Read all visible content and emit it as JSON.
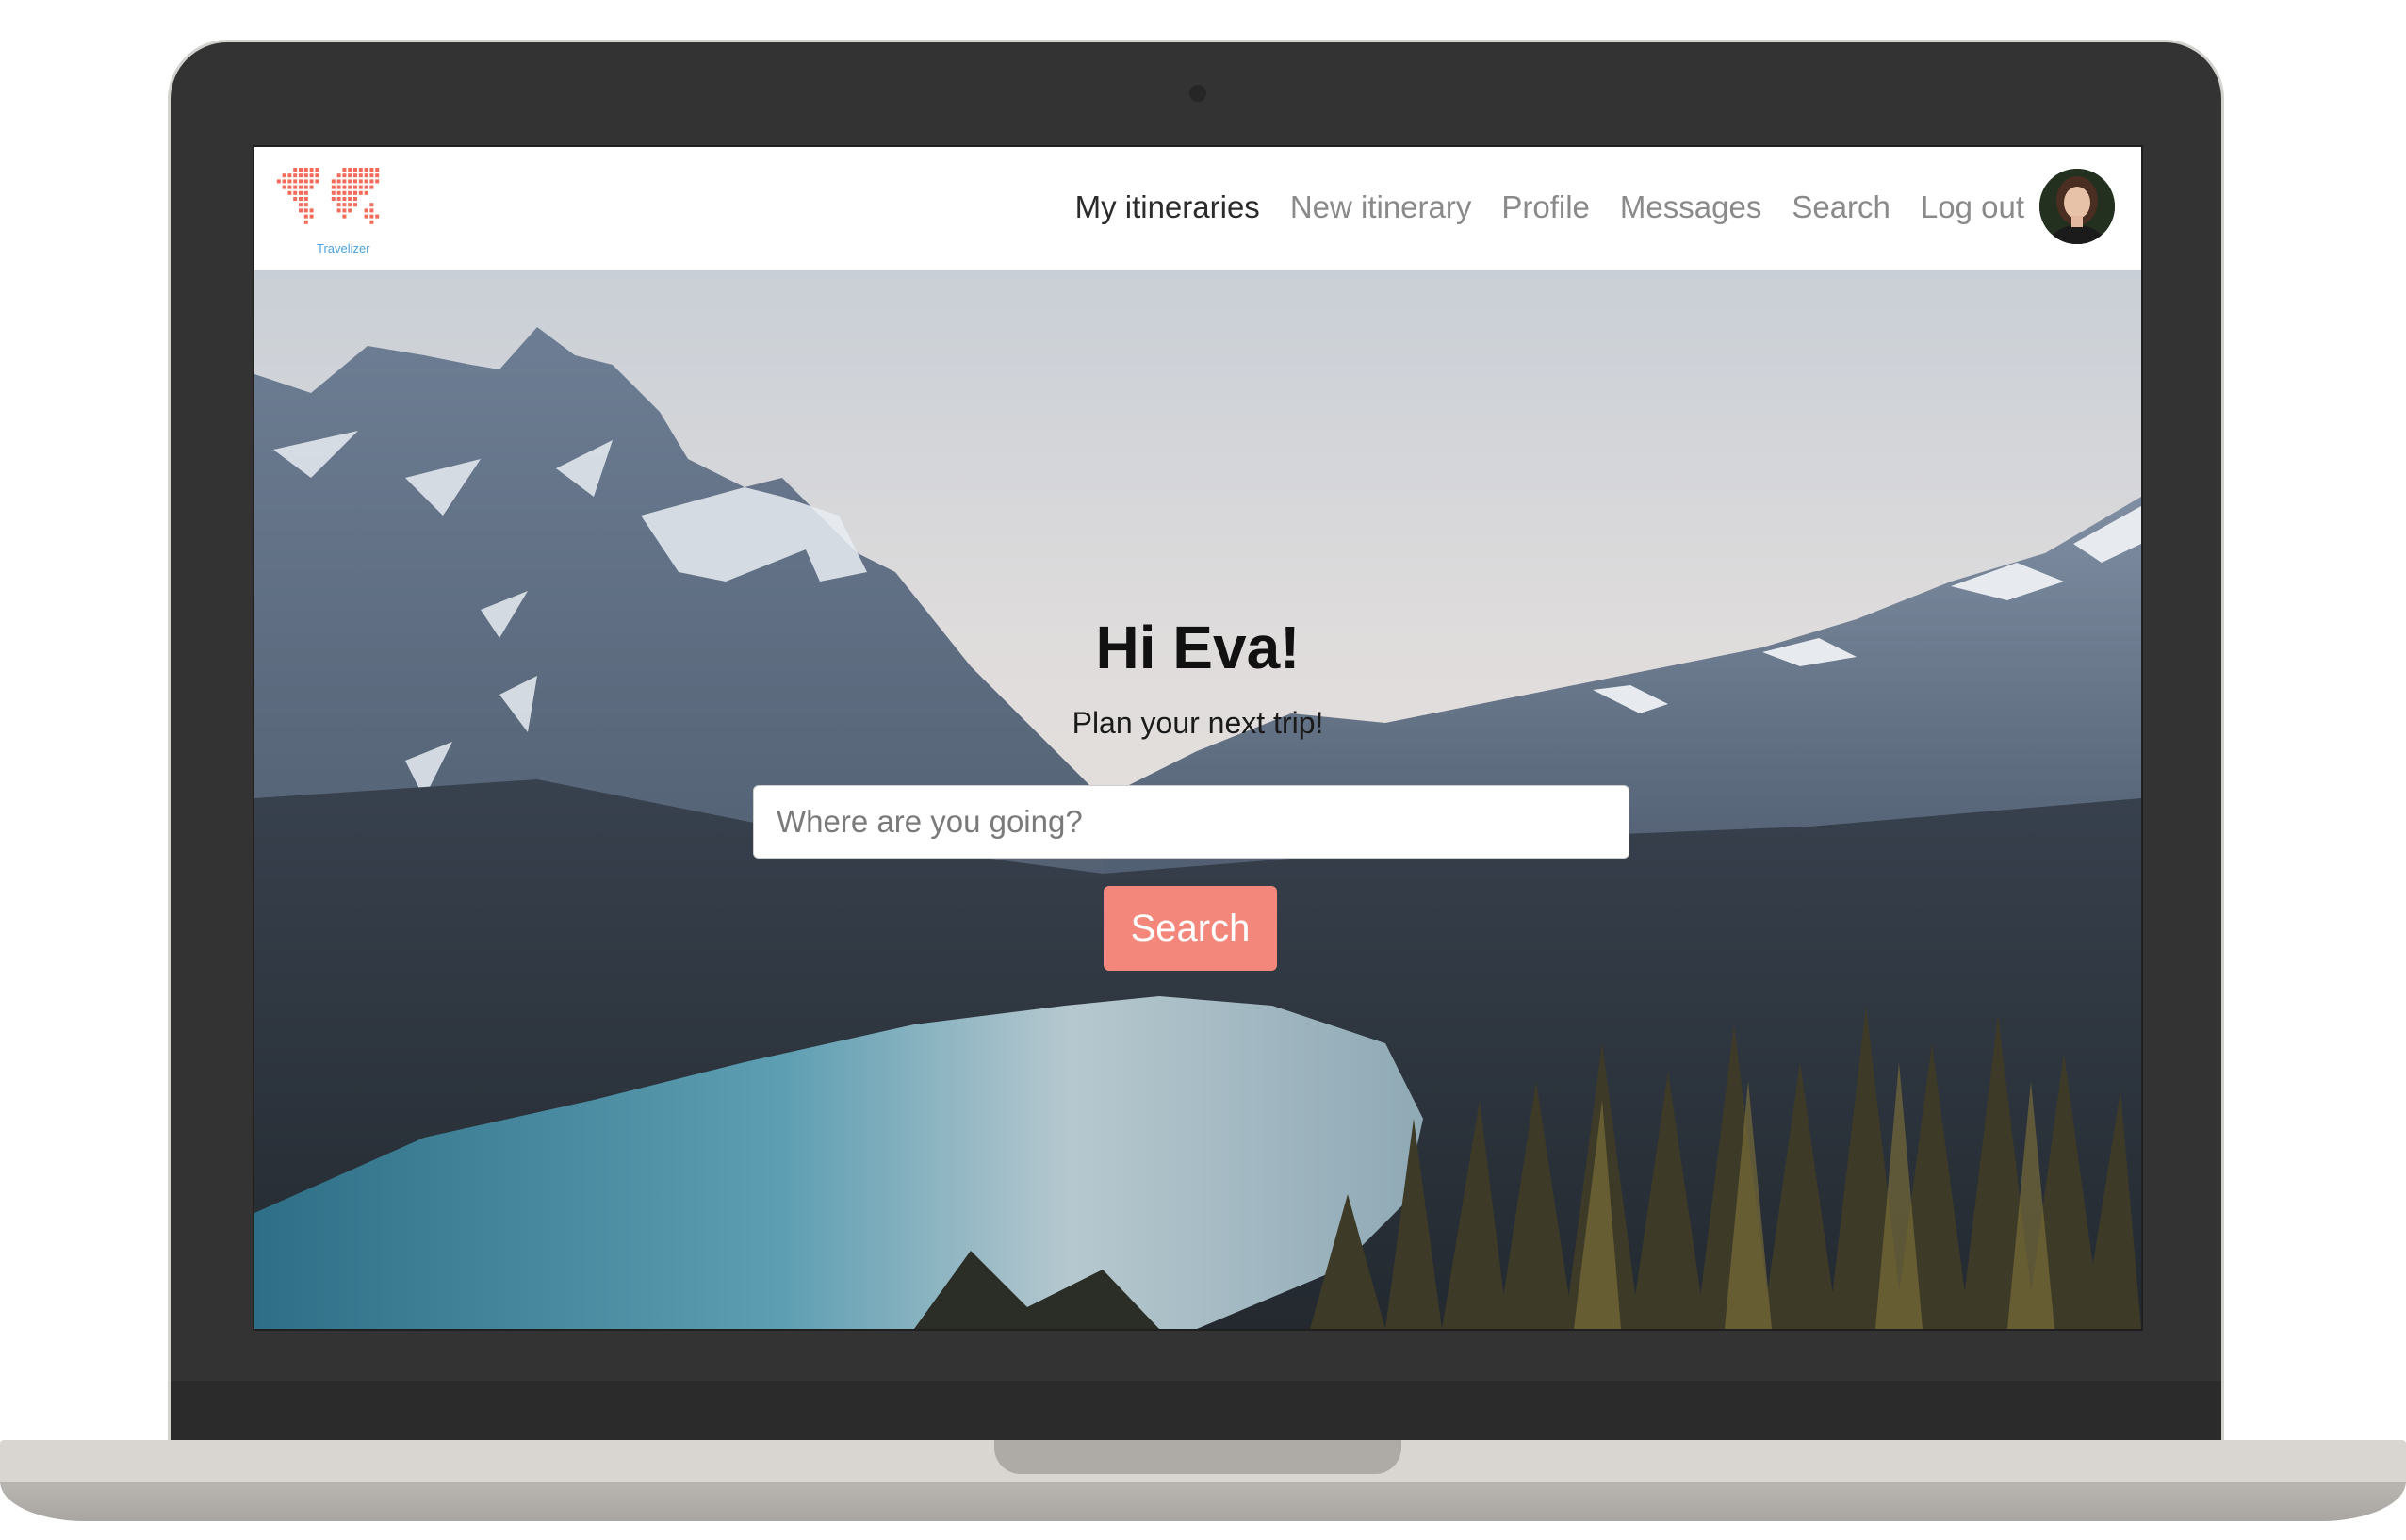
{
  "app": {
    "logo_text": "Travelizer"
  },
  "nav": {
    "items": [
      {
        "label": "My itineraries",
        "active": true
      },
      {
        "label": "New itinerary",
        "active": false
      },
      {
        "label": "Profile",
        "active": false
      },
      {
        "label": "Messages",
        "active": false
      },
      {
        "label": "Search",
        "active": false
      },
      {
        "label": "Log out",
        "active": false
      }
    ]
  },
  "hero": {
    "greeting": "Hi Eva!",
    "subtitle": "Plan your next trip!",
    "search_placeholder": "Where are you going?",
    "search_button": "Search"
  },
  "colors": {
    "accent": "#f4877b",
    "logo": "#f26b5b",
    "nav_active": "#2b2b2b",
    "nav_inactive": "#8a8a8a"
  },
  "icons": {
    "logo": "world-map-dots-icon",
    "avatar": "user-avatar"
  }
}
